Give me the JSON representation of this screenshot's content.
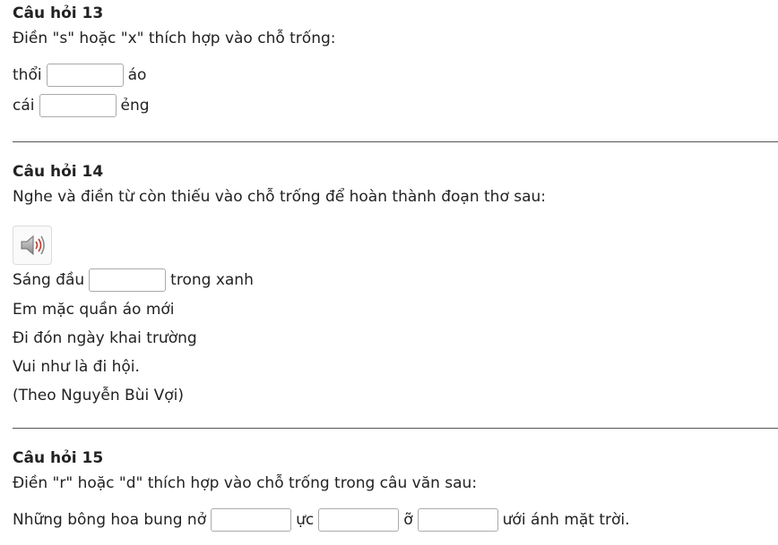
{
  "q13": {
    "title": "Câu hỏi 13",
    "prompt": "Điền \"s\" hoặc \"x\" thích hợp vào chỗ trống:",
    "rows": [
      {
        "before": "thổi",
        "after": "áo"
      },
      {
        "before": "cái",
        "after": "ẻng"
      }
    ]
  },
  "q14": {
    "title": "Câu hỏi 14",
    "prompt": "Nghe và điền từ còn thiếu vào chỗ trống để hoàn thành đoạn thơ sau:",
    "line1_before": "Sáng đầu",
    "line1_after": "trong xanh",
    "lines": [
      "Em mặc quần áo mới",
      "Đi đón ngày khai trường",
      "Vui như là đi hội.",
      "(Theo Nguyễn Bùi Vợi)"
    ]
  },
  "q15": {
    "title": "Câu hỏi 15",
    "prompt": "Điền \"r\" hoặc \"d\" thích hợp vào chỗ trống trong câu văn sau:",
    "seg1": "Những bông hoa bung nở",
    "seg2": "ực",
    "seg3": "ỡ",
    "seg4": "ưới ánh mặt trời."
  }
}
